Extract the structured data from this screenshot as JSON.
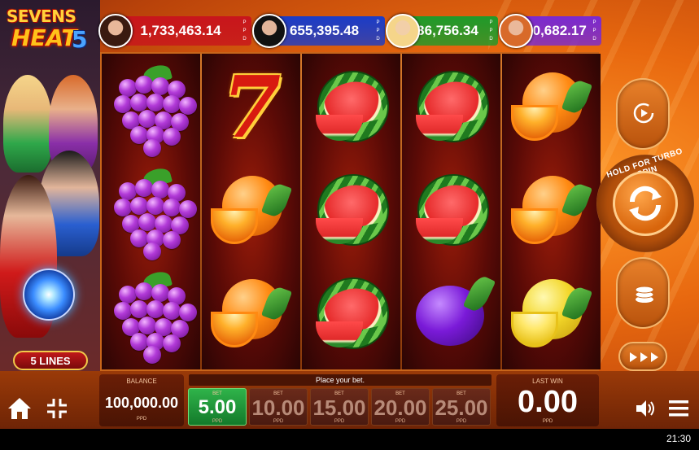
{
  "game": {
    "logo": {
      "line1": "SEVENS",
      "line2": "HEAT",
      "line3": "5"
    },
    "lines_label": "5 LINES"
  },
  "jackpots": [
    {
      "value": "1,733,463.14",
      "ppd": [
        "P",
        "P",
        "D"
      ],
      "color": "#c8151c"
    },
    {
      "value": "655,395.48",
      "ppd": [
        "P",
        "P",
        "D"
      ],
      "color": "#1a3cc8"
    },
    {
      "value": "36,756.34",
      "ppd": [
        "P",
        "P",
        "D"
      ],
      "color": "#1f9a2a"
    },
    {
      "value": "10,682.17",
      "ppd": [
        "P",
        "P",
        "D"
      ],
      "color": "#7a2ad0"
    }
  ],
  "reels": [
    [
      "grapes",
      "grapes",
      "grapes"
    ],
    [
      "seven",
      "orange",
      "orange"
    ],
    [
      "watermelon",
      "watermelon",
      "watermelon"
    ],
    [
      "watermelon",
      "watermelon",
      "plum"
    ],
    [
      "orange",
      "orange",
      "lemon"
    ]
  ],
  "controls": {
    "turbo_label": "HOLD FOR TURBO SPIN",
    "autoplay_icon": "replay-icon",
    "spin_icon": "spin-arrows-icon",
    "coins_icon": "coins-icon",
    "fast_icon": "fast-forward-icon"
  },
  "bottom": {
    "balance_label": "BALANCE",
    "balance_value": "100,000.00",
    "balance_ppd": "PPD",
    "place_bet": "Place your bet.",
    "bets": [
      {
        "label": "BET",
        "value": "5.00",
        "ppd": "PPD",
        "selected": true
      },
      {
        "label": "BET",
        "value": "10.00",
        "ppd": "PPD",
        "selected": false
      },
      {
        "label": "BET",
        "value": "15.00",
        "ppd": "PPD",
        "selected": false
      },
      {
        "label": "BET",
        "value": "20.00",
        "ppd": "PPD",
        "selected": false
      },
      {
        "label": "BET",
        "value": "25.00",
        "ppd": "PPD",
        "selected": false
      }
    ],
    "last_win_label": "LAST WIN",
    "last_win_value": "0.00",
    "last_win_ppd": "PPD"
  },
  "system": {
    "clock": "21:30"
  }
}
